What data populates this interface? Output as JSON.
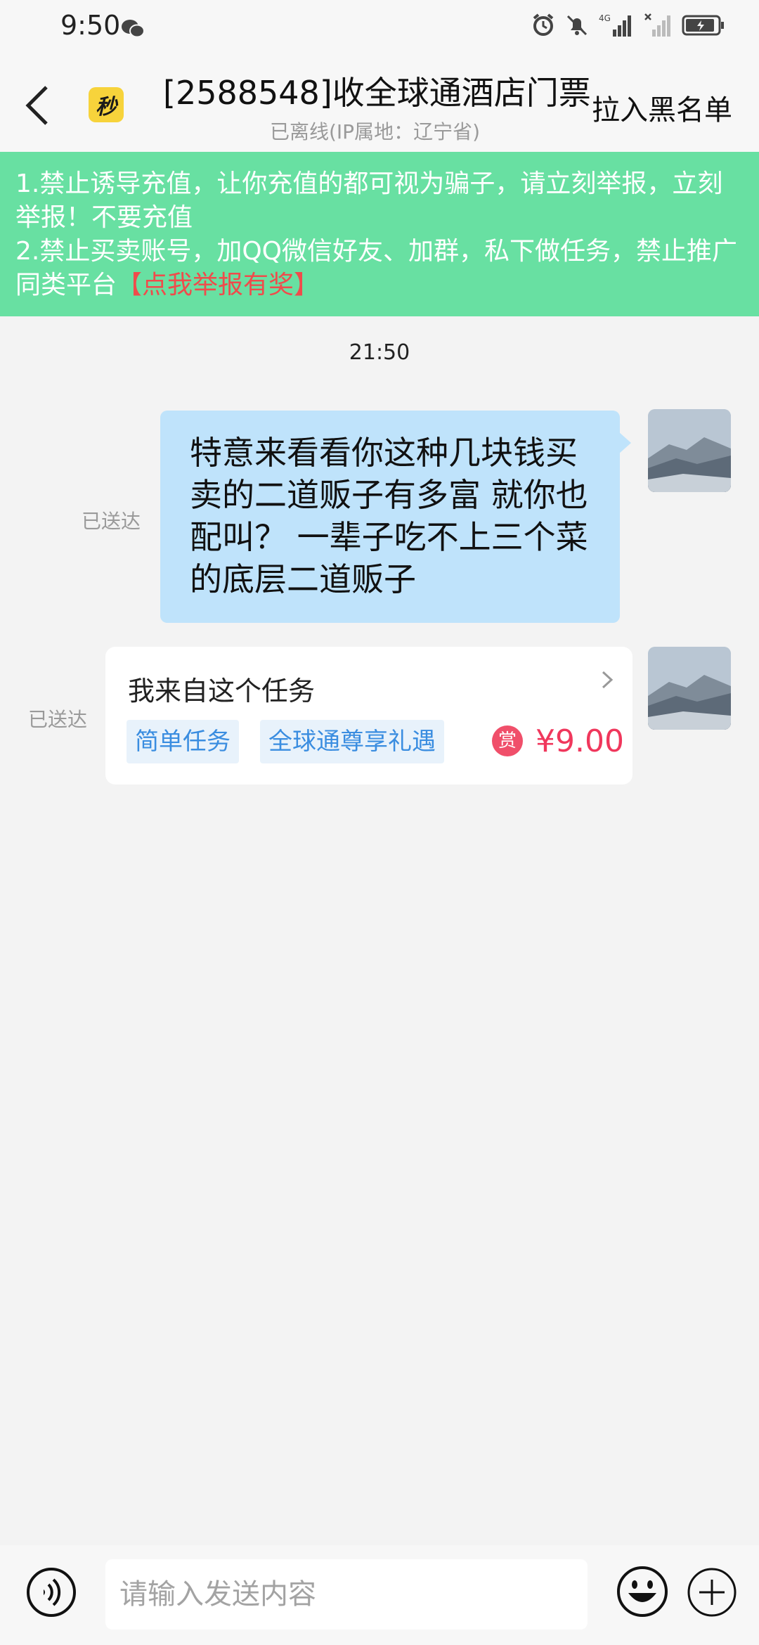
{
  "status_bar": {
    "time": "9:50",
    "network": "4G",
    "icons": [
      "wechat-icon",
      "alarm-icon",
      "mute-icon",
      "signal-icon",
      "no-signal-icon",
      "battery-charging-icon"
    ]
  },
  "header": {
    "title": "[2588548]收全球通酒店门票",
    "subtitle": "已离线(IP属地：辽宁省)",
    "action": "拉入黑名单",
    "logo_text": "秒"
  },
  "notice": {
    "line1": "1.禁止诱导充值，让你充值的都可视为骗子，请立刻举报，立刻举报！不要充值",
    "line2": "2.禁止买卖账号，加QQ微信好友、加群，私下做任务，禁止推广同类平台",
    "report_link": "【点我举报有奖】",
    "colors": {
      "background": "#68e0a2",
      "link": "#f04b4b"
    }
  },
  "chat": {
    "time_divider": "21:50",
    "messages": [
      {
        "status": "已送达",
        "text": "特意来看看你这种几块钱买卖的二道贩子有多富 就你也配叫？ 一辈子吃不上三个菜的底层二道贩子"
      },
      {
        "status": "已送达",
        "card": {
          "title": "我来自这个任务",
          "tags": [
            "简单任务",
            "全球通尊享礼遇"
          ],
          "reward_icon_text": "赏",
          "reward": "¥9.00"
        }
      }
    ]
  },
  "input": {
    "placeholder": "请输入发送内容"
  }
}
